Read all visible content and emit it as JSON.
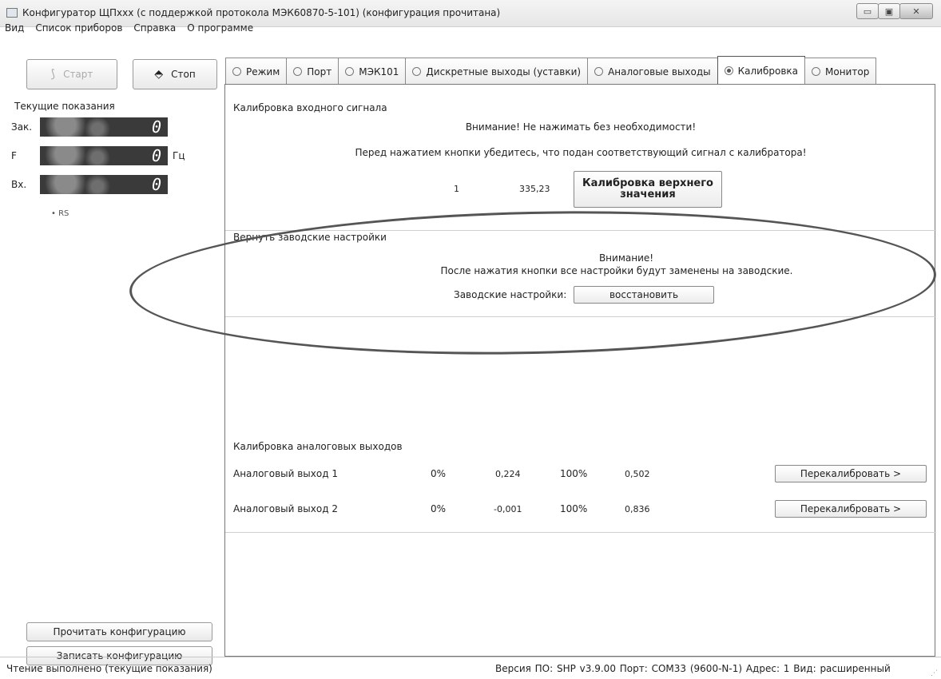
{
  "window": {
    "title": "Конфигуратор ЩПxxx (с поддержкой протокола МЭК60870-5-101) (конфигурация прочитана)",
    "min_symbol": "▭",
    "max_symbol": "▣",
    "close_symbol": "✕"
  },
  "menu": {
    "items": [
      "Вид",
      "Список приборов",
      "Справка",
      "О программе"
    ]
  },
  "left": {
    "start_label": "Старт",
    "stop_label": "Стоп",
    "current_readings_label": "Текущие показания",
    "meters": [
      {
        "label": "Зак.",
        "value": "0",
        "unit": ""
      },
      {
        "label": "F",
        "value": "0",
        "unit": "Гц"
      },
      {
        "label": "Вх.",
        "value": "0",
        "unit": ""
      }
    ],
    "rs_label": "RS",
    "read_config_label": "Прочитать конфигурацию",
    "write_config_label": "Записать конфигурацию"
  },
  "tabs": [
    {
      "label": "Режим"
    },
    {
      "label": "Порт"
    },
    {
      "label": "МЭК101"
    },
    {
      "label": "Дискретные выходы (уставки)"
    },
    {
      "label": "Аналоговые выходы"
    },
    {
      "label": "Калибровка"
    },
    {
      "label": "Монитор"
    }
  ],
  "active_tab": "Калибровка",
  "calibration": {
    "input_section_title": "Калибровка входного сигнала",
    "warning_line": "Внимание! Не нажимать без необходимости!",
    "instruction_line": "Перед нажатием кнопки убедитесь, что подан соответствующий сигнал с калибратора!",
    "index": "1",
    "value": "335,23",
    "calib_upper_button": "Калибровка верхнего значения",
    "factory_section_title": "Вернуть заводские настройки",
    "factory_warning_title": "Внимание!",
    "factory_warning_text": "После нажатия кнопки все настройки будут заменены на заводские.",
    "factory_settings_label": "Заводские настройки:",
    "restore_button": "восстановить",
    "analog_section_title": "Калибровка аналоговых выходов",
    "analog_outputs": [
      {
        "name": "Аналоговый выход 1",
        "pct_low": "0%",
        "val_low": "0,224",
        "pct_high": "100%",
        "val_high": "0,502",
        "button": "Перекалибровать >"
      },
      {
        "name": "Аналоговый выход 2",
        "pct_low": "0%",
        "val_low": "-0,001",
        "pct_high": "100%",
        "val_high": "0,836",
        "button": "Перекалибровать >"
      }
    ]
  },
  "status": {
    "left": "Чтение выполнено (текущие показания)",
    "right": "Версия ПО: SHP v3.9.00    Порт: COM33 (9600-N-1)   Адрес: 1   Вид: расширенный"
  }
}
